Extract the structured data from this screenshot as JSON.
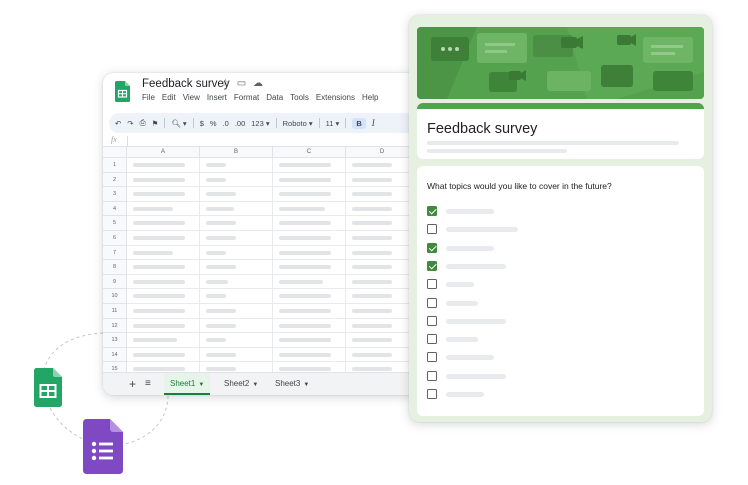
{
  "sheets": {
    "doc_title": "Feedback survey",
    "title_icons": "☆ ▭ ☁",
    "menu": [
      "File",
      "Edit",
      "View",
      "Insert",
      "Format",
      "Data",
      "Tools",
      "Extensions",
      "Help"
    ],
    "toolbar": {
      "undo": "↶",
      "redo": "↷",
      "print": "⎙",
      "paint": "⚑",
      "zoom": "🔍︎ ▾",
      "currency": "$",
      "percent": "%",
      "dec_minus": ".0",
      "dec_plus": ".00",
      "format_num": "123 ▾",
      "font": "Roboto ▾",
      "size": "11 ▾",
      "bold": "B",
      "italic": "I"
    },
    "formula_label": "fx",
    "columns": [
      "A",
      "B",
      "C",
      "D"
    ],
    "rows": [
      "1",
      "2",
      "3",
      "4",
      "5",
      "6",
      "7",
      "8",
      "9",
      "10",
      "11",
      "12",
      "13",
      "14",
      "15"
    ],
    "tabs": {
      "add": "+",
      "list": "≡",
      "items": [
        {
          "label": "Sheet1",
          "caret": "▼"
        },
        {
          "label": "Sheet2",
          "caret": "▼"
        },
        {
          "label": "Sheet3",
          "caret": "▼"
        }
      ]
    },
    "accent": "#188038"
  },
  "form": {
    "title": "Feedback survey",
    "question": "What topics would you like to cover in the future?",
    "options": [
      {
        "checked": true
      },
      {
        "checked": false
      },
      {
        "checked": true
      },
      {
        "checked": true
      },
      {
        "checked": false
      },
      {
        "checked": false
      },
      {
        "checked": false
      },
      {
        "checked": false
      },
      {
        "checked": false
      },
      {
        "checked": false
      },
      {
        "checked": false
      }
    ],
    "theme_color": "#55a24e",
    "background_color": "#e6f0e0"
  },
  "icons": {
    "sheets_app": "google-sheets-icon",
    "forms_app": "google-forms-icon"
  }
}
